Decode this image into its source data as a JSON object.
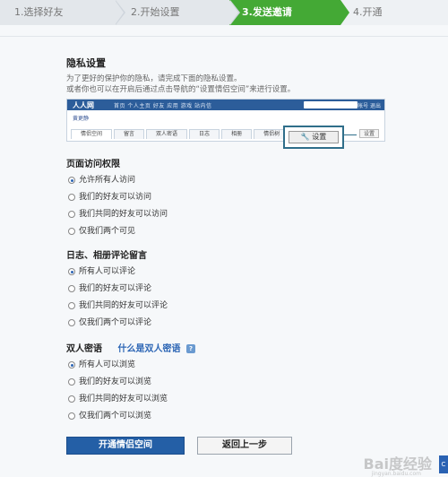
{
  "steps": [
    {
      "label": "1.选择好友"
    },
    {
      "label": "2.开始设置"
    },
    {
      "label": "3.发送邀请"
    },
    {
      "label": "4.开通"
    }
  ],
  "privacy": {
    "title": "隐私设置",
    "desc1": "为了更好的保护你的隐私，请完成下面的隐私设置。",
    "desc2": "或者你也可以在开启后通过点击导航的“设置情侣空间”来进行设置。"
  },
  "mock": {
    "logo": "人人网",
    "nav": "首页  个人主页  好友  应用  游戏  站内信",
    "right": "帐号  退出",
    "user": "黄更静",
    "tabs": [
      "情侣空间",
      "留言",
      "双人密语",
      "日志",
      "相册",
      "情侣树"
    ],
    "small_set": "设置",
    "big_set": "设置"
  },
  "page_access": {
    "title": "页面访问权限",
    "options": [
      "允许所有人访问",
      "我们的好友可以访问",
      "我们共同的好友可以访问",
      "仅我们两个可见"
    ],
    "selected": 0
  },
  "blog_comment": {
    "title": "日志、相册评论留言",
    "options": [
      "所有人可以评论",
      "我们的好友可以评论",
      "我们共同的好友可以评论",
      "仅我们两个可以评论"
    ],
    "selected": 0
  },
  "secret": {
    "title": "双人密语",
    "help": "什么是双人密语",
    "help_icon": "?",
    "options": [
      "所有人可以浏览",
      "我们的好友可以浏览",
      "我们共同的好友可以浏览",
      "仅我们两个可以浏览"
    ],
    "selected": 0
  },
  "buttons": {
    "primary": "开通情侣空间",
    "secondary": "返回上一步"
  },
  "watermark": "Bai度经验",
  "watermark_sub": "jingyan.baidu.com",
  "edge": "C",
  "colors": {
    "accent_green": "#44a935",
    "primary_blue": "#245fa6",
    "link_blue": "#2d66b5"
  }
}
